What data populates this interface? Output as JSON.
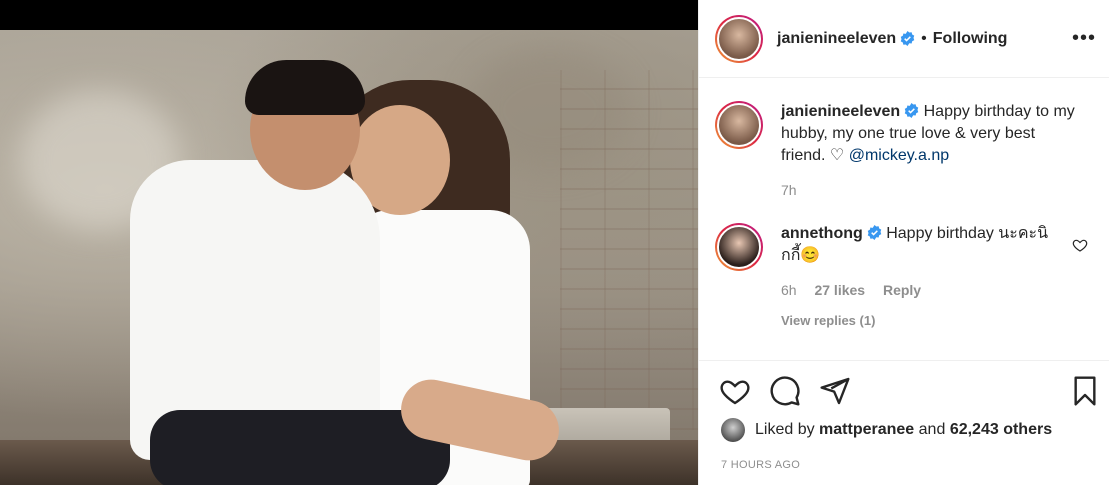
{
  "post": {
    "username": "janienineeleven",
    "follow_separator": "•",
    "follow_status": "Following",
    "more_label": "•••"
  },
  "caption": {
    "username": "janienineeleven",
    "text": "Happy birthday to my hubby, my one true love & very best friend.",
    "heart": "♡",
    "mention": "@mickey.a.np",
    "time": "7h"
  },
  "comments": [
    {
      "username": "annethong",
      "text": "Happy birthday นะคะนิกกี้😊",
      "time": "6h",
      "likes": "27 likes",
      "reply": "Reply",
      "view_replies": "View replies (1)"
    }
  ],
  "likes": {
    "prefix": "Liked by",
    "user": "mattperanee",
    "conj": "and",
    "count": "62,243 others"
  },
  "timestamp": "7 HOURS AGO",
  "icons": [
    "heart-icon",
    "comment-icon",
    "share-icon",
    "bookmark-icon",
    "more-icon",
    "verified-icon"
  ],
  "colors": {
    "verified": "#3897f0",
    "mention": "#00376b",
    "muted": "#8e8e8e"
  }
}
